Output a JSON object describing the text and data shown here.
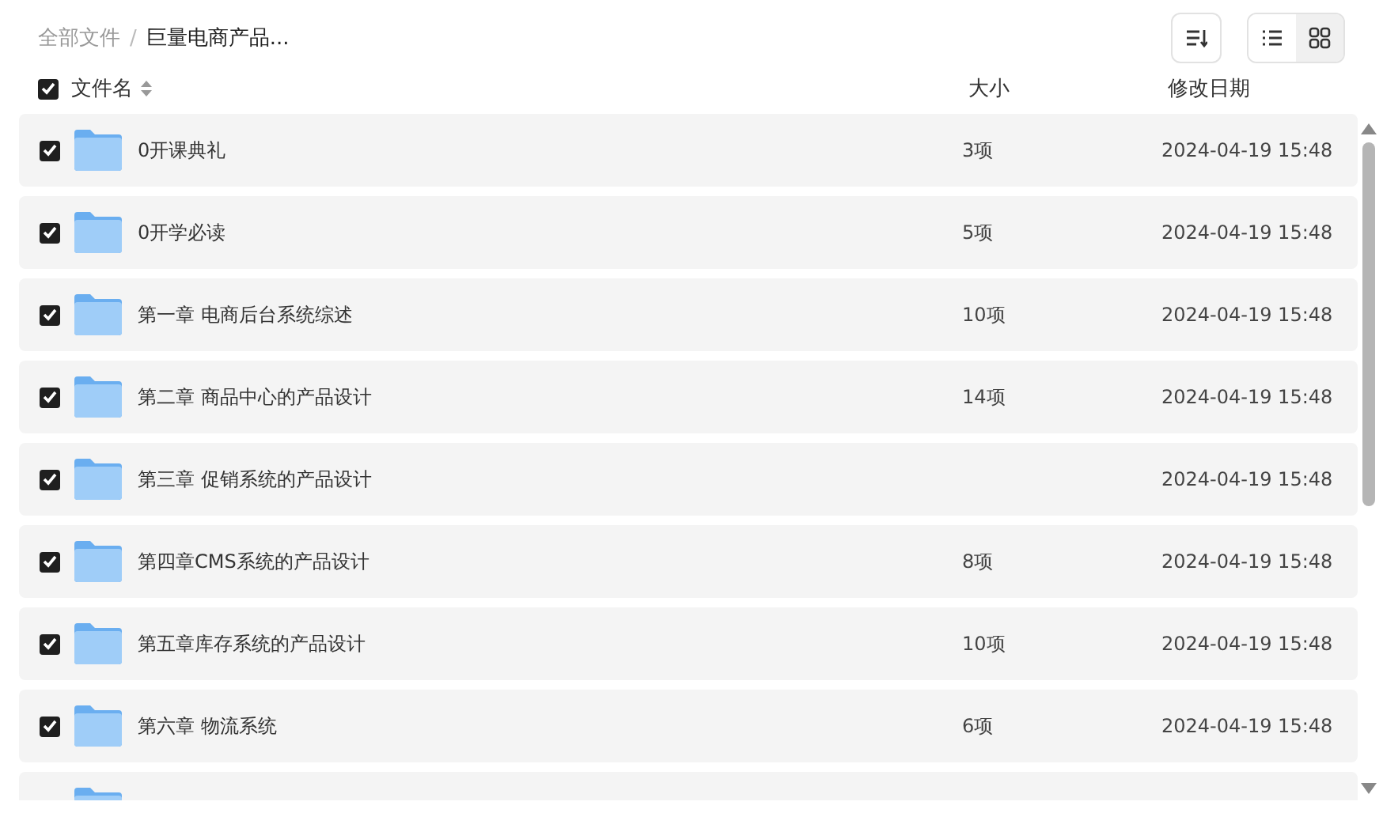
{
  "breadcrumb_separator": "/",
  "breadcrumb": [
    {
      "label": "全部文件",
      "current": false
    },
    {
      "label": "巨量电商产品...",
      "current": true
    }
  ],
  "toolbar": {
    "views": [
      {
        "kind": "list",
        "selected": false
      },
      {
        "kind": "grid",
        "selected": true
      }
    ]
  },
  "table": {
    "select_all": {
      "checked": true
    },
    "columns": [
      "文件名",
      "大小",
      "修改日期"
    ],
    "rows": [
      {
        "checked": true,
        "name": "0开课典礼",
        "size": "3项",
        "date": "2024-04-19 15:48"
      },
      {
        "checked": true,
        "name": "0开学必读",
        "size": "5项",
        "date": "2024-04-19 15:48"
      },
      {
        "checked": true,
        "name": "第一章 电商后台系统综述",
        "size": "10项",
        "date": "2024-04-19 15:48"
      },
      {
        "checked": true,
        "name": "第二章 商品中心的产品设计",
        "size": "14项",
        "date": "2024-04-19 15:48"
      },
      {
        "checked": true,
        "name": "第三章 促销系统的产品设计",
        "date": "2024-04-19 15:48"
      },
      {
        "checked": true,
        "name": "第四章CMS系统的产品设计",
        "size": "8项",
        "date": "2024-04-19 15:48"
      },
      {
        "checked": true,
        "name": "第五章库存系统的产品设计",
        "size": "10项",
        "date": "2024-04-19 15:48"
      },
      {
        "checked": true,
        "name": "第六章 物流系统",
        "size": "6项",
        "date": "2024-04-19 15:48"
      },
      {}
    ]
  }
}
